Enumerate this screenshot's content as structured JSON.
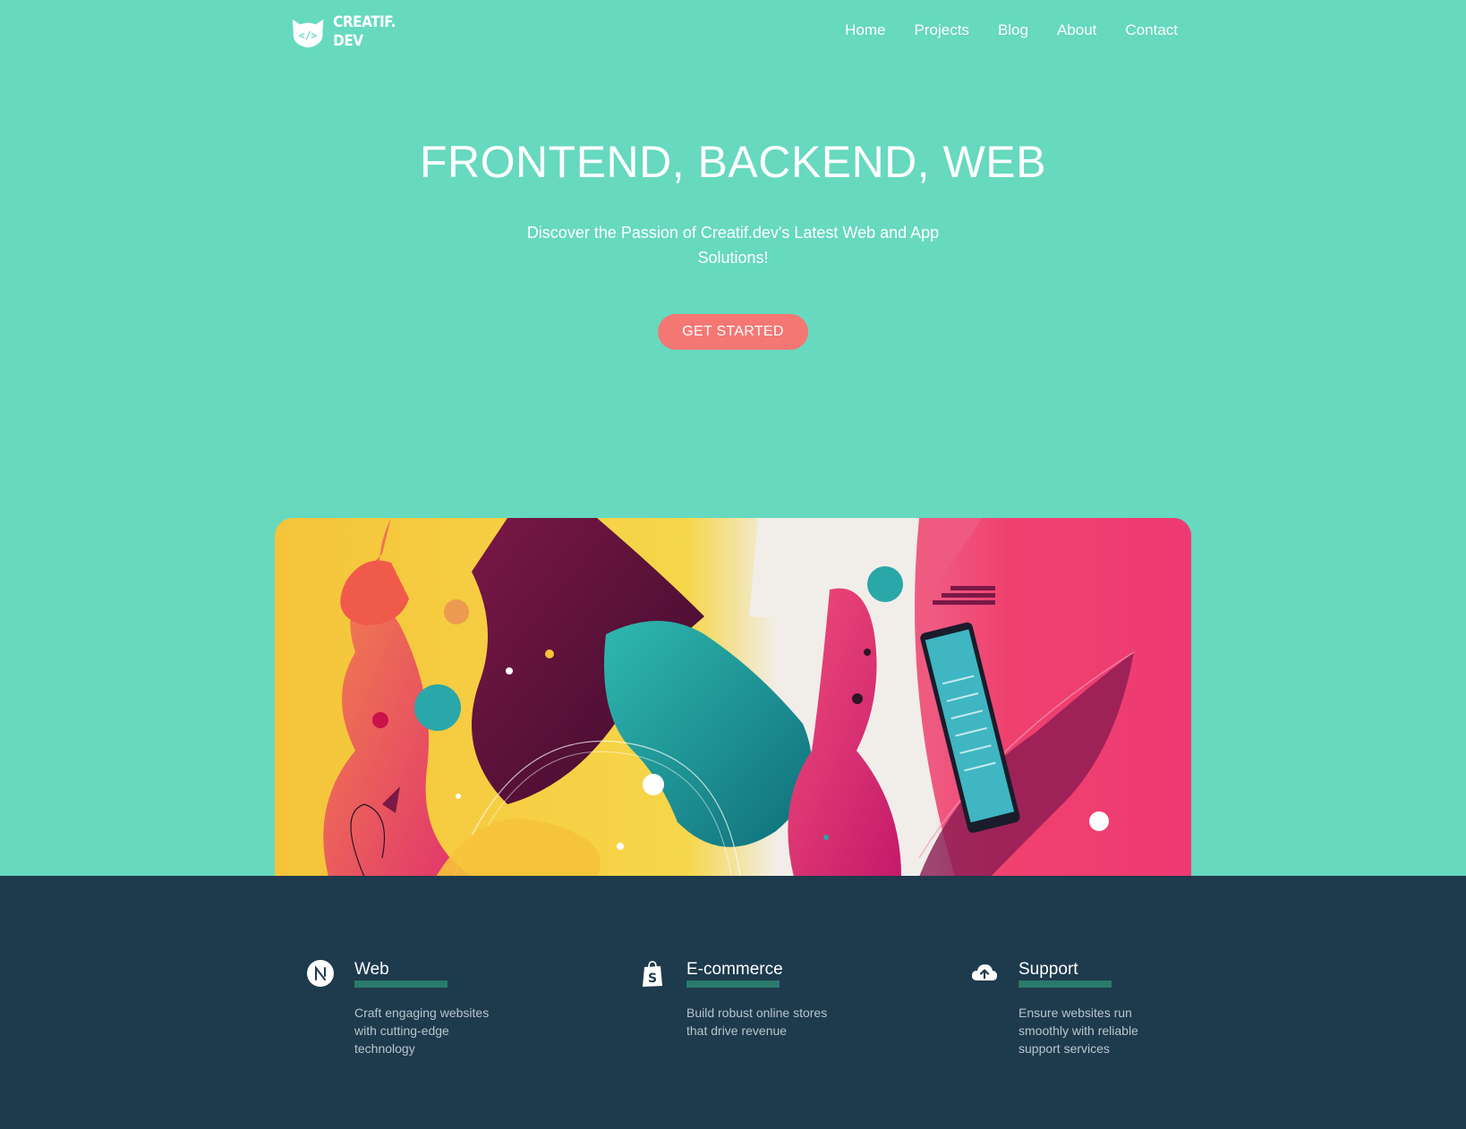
{
  "brand": {
    "logo_line1": "CREATIF.",
    "logo_line2": "DEV",
    "logo_glyph": "</>",
    "primary_color": "#66d9bf",
    "dark_color": "#1e3a4d",
    "accent_color": "#f47774"
  },
  "nav": {
    "items": [
      {
        "label": "Home"
      },
      {
        "label": "Projects"
      },
      {
        "label": "Blog"
      },
      {
        "label": "About"
      },
      {
        "label": "Contact"
      }
    ]
  },
  "hero": {
    "title": "FRONTEND, BACKEND, WEB",
    "subtitle": "Discover the Passion of Creatif.dev's Latest Web and App Solutions!",
    "cta_label": "GET STARTED"
  },
  "services": [
    {
      "icon": "nextjs-icon",
      "title": "Web",
      "description": "Craft engaging websites with cutting-edge technology"
    },
    {
      "icon": "shopify-icon",
      "title": "E-commerce",
      "description": "Build robust online stores that drive revenue"
    },
    {
      "icon": "cloud-upload-icon",
      "title": "Support",
      "description": "Ensure websites run smoothly with reliable support services"
    }
  ]
}
